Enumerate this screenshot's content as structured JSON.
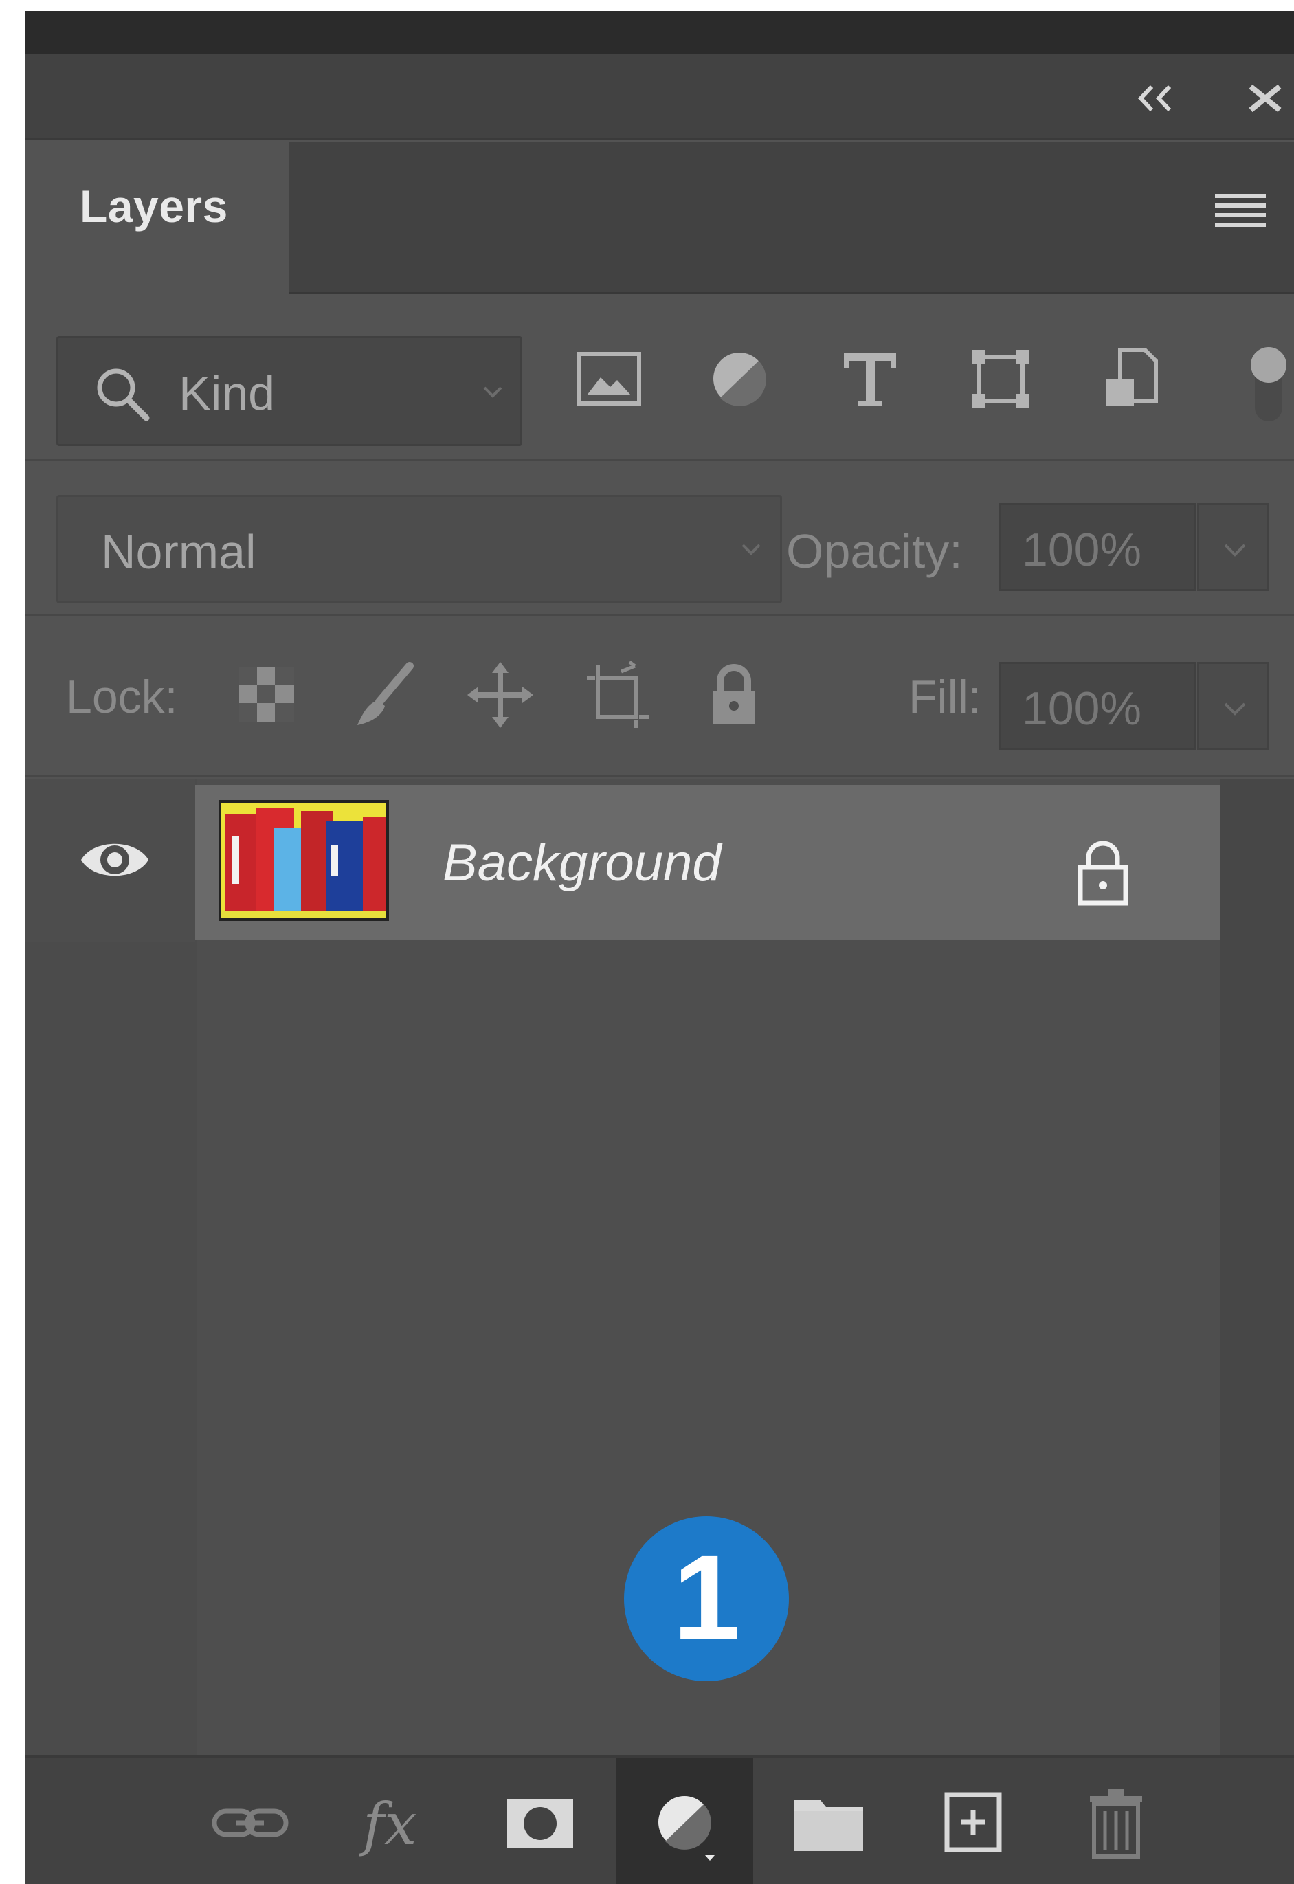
{
  "panel": {
    "tab_label": "Layers",
    "filter": {
      "kind_label": "Kind"
    },
    "blend_mode": "Normal",
    "opacity_label": "Opacity:",
    "opacity_value": "100%",
    "lock_label": "Lock:",
    "fill_label": "Fill:",
    "fill_value": "100%",
    "layers": [
      {
        "name": "Background",
        "visible": true,
        "locked": true
      }
    ],
    "badge_number": "1"
  },
  "icons": {
    "header": [
      "collapse-icon",
      "close-icon",
      "panel-menu-icon"
    ],
    "filters": [
      "pixel-layer-filter-icon",
      "adjustment-layer-filter-icon",
      "type-layer-filter-icon",
      "shape-layer-filter-icon",
      "smart-object-filter-icon"
    ],
    "locks": [
      "lock-transparent-pixels-icon",
      "lock-image-pixels-icon",
      "lock-position-icon",
      "lock-artboard-icon",
      "lock-all-icon"
    ],
    "bottom": [
      "link-layers-icon",
      "fx-icon",
      "mask-icon",
      "adjustment-layer-icon",
      "group-folder-icon",
      "new-layer-icon",
      "trash-icon"
    ]
  },
  "colors": {
    "panel_bg": "#535353",
    "header_bg": "#424242",
    "selected_layer": "#6a6a6a",
    "badge": "#1d7ac9"
  }
}
